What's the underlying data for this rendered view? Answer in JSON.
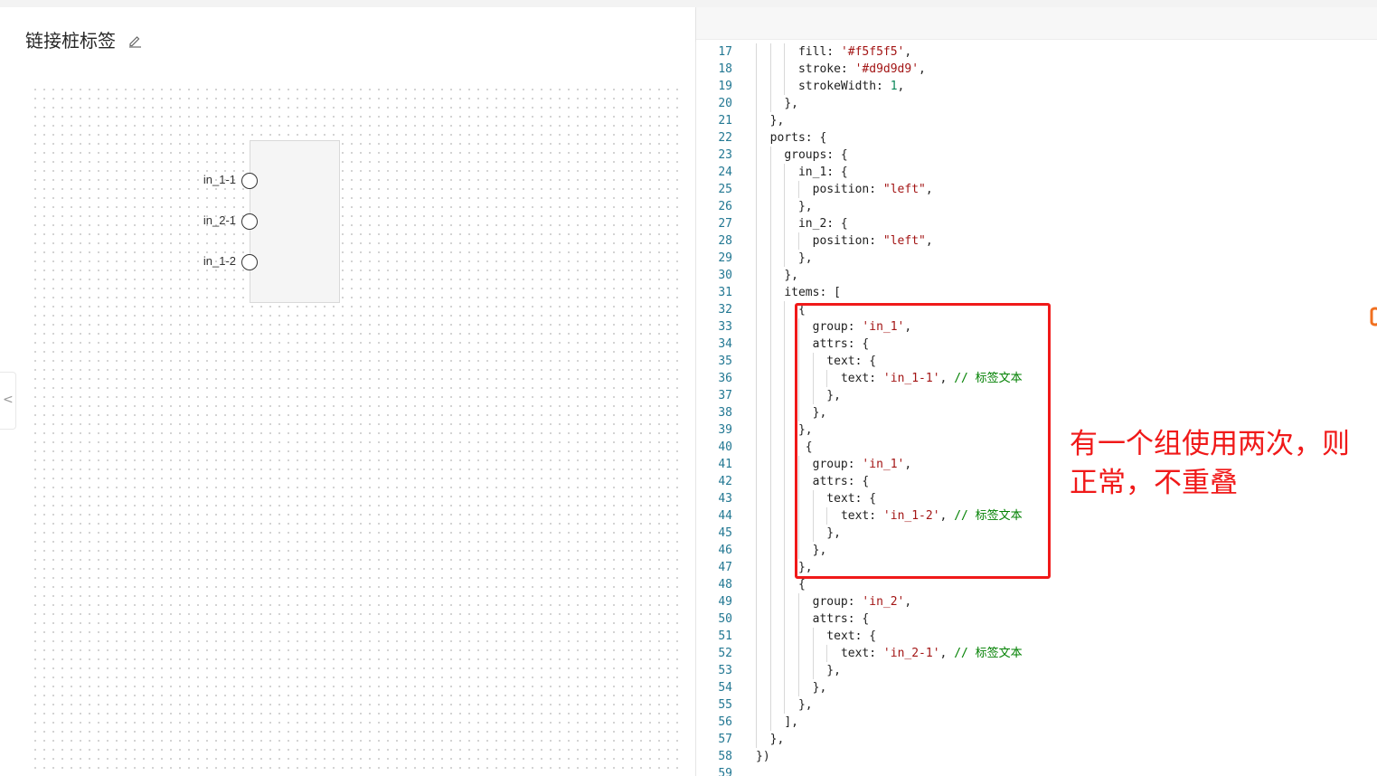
{
  "left_panel": {
    "title": "链接桩标签",
    "collapse_glyph": "<",
    "node": {
      "fill": "#f5f5f5",
      "stroke": "#d9d9d9",
      "ports": [
        {
          "label": "in_1-1"
        },
        {
          "label": "in_2-1"
        },
        {
          "label": "in_1-2"
        }
      ]
    }
  },
  "editor": {
    "lines": [
      {
        "n": "17",
        "indent": 3,
        "tokens": [
          [
            "p",
            "fill: "
          ],
          [
            "s",
            "'#f5f5f5'"
          ],
          [
            "p",
            ","
          ]
        ]
      },
      {
        "n": "18",
        "indent": 3,
        "tokens": [
          [
            "p",
            "stroke: "
          ],
          [
            "s",
            "'#d9d9d9'"
          ],
          [
            "p",
            ","
          ]
        ]
      },
      {
        "n": "19",
        "indent": 3,
        "tokens": [
          [
            "p",
            "strokeWidth: "
          ],
          [
            "n",
            "1"
          ],
          [
            "p",
            ","
          ]
        ]
      },
      {
        "n": "20",
        "indent": 2,
        "tokens": [
          [
            "p",
            "},"
          ]
        ]
      },
      {
        "n": "21",
        "indent": 1,
        "tokens": [
          [
            "p",
            "},"
          ]
        ]
      },
      {
        "n": "22",
        "indent": 1,
        "tokens": [
          [
            "p",
            "ports: {"
          ]
        ]
      },
      {
        "n": "23",
        "indent": 2,
        "tokens": [
          [
            "p",
            "groups: {"
          ]
        ]
      },
      {
        "n": "24",
        "indent": 3,
        "tokens": [
          [
            "p",
            "in_1: {"
          ]
        ]
      },
      {
        "n": "25",
        "indent": 4,
        "tokens": [
          [
            "p",
            "position: "
          ],
          [
            "s",
            "\"left\""
          ],
          [
            "p",
            ","
          ]
        ]
      },
      {
        "n": "26",
        "indent": 3,
        "tokens": [
          [
            "p",
            "},"
          ]
        ]
      },
      {
        "n": "27",
        "indent": 3,
        "tokens": [
          [
            "p",
            "in_2: {"
          ]
        ]
      },
      {
        "n": "28",
        "indent": 4,
        "tokens": [
          [
            "p",
            "position: "
          ],
          [
            "s",
            "\"left\""
          ],
          [
            "p",
            ","
          ]
        ]
      },
      {
        "n": "29",
        "indent": 3,
        "tokens": [
          [
            "p",
            "},"
          ]
        ]
      },
      {
        "n": "30",
        "indent": 2,
        "tokens": [
          [
            "p",
            "},"
          ]
        ]
      },
      {
        "n": "31",
        "indent": 2,
        "tokens": [
          [
            "p",
            "items: ["
          ]
        ]
      },
      {
        "n": "32",
        "indent": 3,
        "tokens": [
          [
            "p",
            "{"
          ]
        ]
      },
      {
        "n": "33",
        "indent": 4,
        "tokens": [
          [
            "p",
            "group: "
          ],
          [
            "s",
            "'in_1'"
          ],
          [
            "p",
            ","
          ]
        ]
      },
      {
        "n": "34",
        "indent": 4,
        "tokens": [
          [
            "p",
            "attrs: {"
          ]
        ]
      },
      {
        "n": "35",
        "indent": 5,
        "tokens": [
          [
            "p",
            "text: {"
          ]
        ]
      },
      {
        "n": "36",
        "indent": 6,
        "tokens": [
          [
            "p",
            "text: "
          ],
          [
            "s",
            "'in_1-1'"
          ],
          [
            "p",
            ", "
          ],
          [
            "c",
            "// 标签文本"
          ]
        ]
      },
      {
        "n": "37",
        "indent": 5,
        "tokens": [
          [
            "p",
            "},"
          ]
        ]
      },
      {
        "n": "38",
        "indent": 4,
        "tokens": [
          [
            "p",
            "},"
          ]
        ]
      },
      {
        "n": "39",
        "indent": 3,
        "tokens": [
          [
            "p",
            "},"
          ]
        ]
      },
      {
        "n": "40",
        "indent": 3,
        "tokens": [
          [
            "p",
            " {"
          ]
        ]
      },
      {
        "n": "41",
        "indent": 4,
        "tokens": [
          [
            "p",
            "group: "
          ],
          [
            "s",
            "'in_1'"
          ],
          [
            "p",
            ","
          ]
        ]
      },
      {
        "n": "42",
        "indent": 4,
        "tokens": [
          [
            "p",
            "attrs: {"
          ]
        ]
      },
      {
        "n": "43",
        "indent": 5,
        "tokens": [
          [
            "p",
            "text: {"
          ]
        ]
      },
      {
        "n": "44",
        "indent": 6,
        "tokens": [
          [
            "p",
            "text: "
          ],
          [
            "s",
            "'in_1-2'"
          ],
          [
            "p",
            ", "
          ],
          [
            "c",
            "// 标签文本"
          ]
        ]
      },
      {
        "n": "45",
        "indent": 5,
        "tokens": [
          [
            "p",
            "},"
          ]
        ]
      },
      {
        "n": "46",
        "indent": 4,
        "tokens": [
          [
            "p",
            "},"
          ]
        ]
      },
      {
        "n": "47",
        "indent": 3,
        "tokens": [
          [
            "p",
            "},"
          ]
        ]
      },
      {
        "n": "48",
        "indent": 3,
        "tokens": [
          [
            "p",
            "{"
          ]
        ]
      },
      {
        "n": "49",
        "indent": 4,
        "tokens": [
          [
            "p",
            "group: "
          ],
          [
            "s",
            "'in_2'"
          ],
          [
            "p",
            ","
          ]
        ]
      },
      {
        "n": "50",
        "indent": 4,
        "tokens": [
          [
            "p",
            "attrs: {"
          ]
        ]
      },
      {
        "n": "51",
        "indent": 5,
        "tokens": [
          [
            "p",
            "text: {"
          ]
        ]
      },
      {
        "n": "52",
        "indent": 6,
        "tokens": [
          [
            "p",
            "text: "
          ],
          [
            "s",
            "'in_2-1'"
          ],
          [
            "p",
            ", "
          ],
          [
            "c",
            "// 标签文本"
          ]
        ]
      },
      {
        "n": "53",
        "indent": 5,
        "tokens": [
          [
            "p",
            "},"
          ]
        ]
      },
      {
        "n": "54",
        "indent": 4,
        "tokens": [
          [
            "p",
            "},"
          ]
        ]
      },
      {
        "n": "55",
        "indent": 3,
        "tokens": [
          [
            "p",
            "},"
          ]
        ]
      },
      {
        "n": "56",
        "indent": 2,
        "tokens": [
          [
            "p",
            "],"
          ]
        ]
      },
      {
        "n": "57",
        "indent": 1,
        "tokens": [
          [
            "p",
            "},"
          ]
        ]
      },
      {
        "n": "58",
        "indent": 0,
        "tokens": [
          [
            "p",
            "})"
          ]
        ]
      },
      {
        "n": "59",
        "indent": 0,
        "tokens": []
      }
    ]
  },
  "annotation": {
    "line1": "有一个组使用两次，则",
    "line2": "正常，不重叠",
    "color": "#f01919"
  },
  "colors": {
    "string": "#a31515",
    "number": "#098658",
    "comment": "#008000",
    "line_number": "#237893"
  }
}
